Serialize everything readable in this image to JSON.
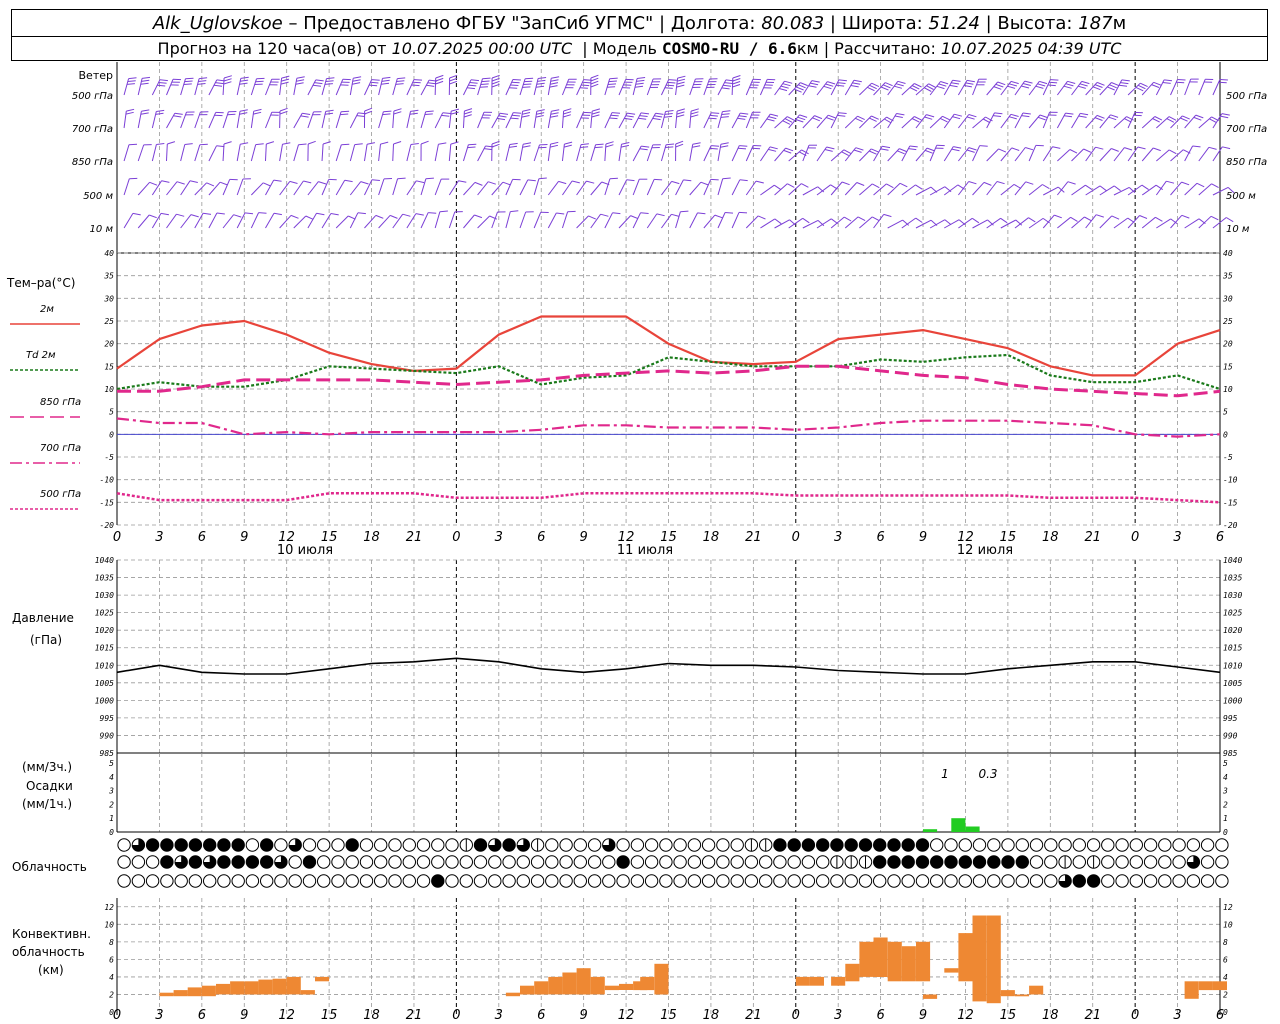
{
  "header": {
    "station": "Alk_Uglovskoe",
    "provider": " – Предоставлено ФГБУ \"ЗапСиб УГМС\" | ",
    "lon_label": "Долгота: ",
    "lon": "80.083",
    "lat_label": " | Широта: ",
    "lat": "51.24",
    "alt_label": " | Высота: ",
    "alt": "187",
    "alt_unit": "м",
    "forecast_label": "Прогноз на 120 часа(ов) от ",
    "forecast_from": "10.07.2025 00:00 UTC",
    "model_label": "  | Модель ",
    "model": "COSMO-RU / 6.6",
    "model_unit": "км",
    "computed_label": " | Рассчитано: ",
    "computed": "10.07.2025 04:39 UTC"
  },
  "labels": {
    "wind": "Ветер",
    "wind_levels": [
      "500 гПа",
      "700 гПа",
      "850 гПа",
      "500 м",
      "10  м"
    ],
    "temp": "Тем–ра(°С)",
    "legend": [
      "2м",
      "Td  2м",
      "850 гПа",
      "700 гПа",
      "500 гПа"
    ],
    "pressure": "Давление",
    "pressure_unit": "(гПа)",
    "precip_3h": "(мм/3ч.)",
    "precip": "Осадки",
    "precip_1h": "(мм/1ч.)",
    "cloud": "Облачность",
    "conv": [
      "Конвективн.",
      "облачность",
      "(км)"
    ],
    "days": [
      "10 июля",
      "11 июля",
      "12 июля"
    ],
    "precip_notes": [
      "1",
      "0.3"
    ]
  },
  "colors": {
    "t2m": "#e8443a",
    "td2m": "#1a7a1a",
    "t850": "#e0288c",
    "t700": "#e0288c",
    "t500": "#e0288c",
    "wind": "#7b3fd6",
    "precip": "#22cc22",
    "conv": "#ee8833",
    "zero_line": "#4444cc"
  },
  "chart_data": [
    {
      "type": "line",
      "name": "temperature",
      "x_hours": [
        0,
        3,
        6,
        9,
        12,
        15,
        18,
        21,
        24,
        27,
        30,
        33,
        36,
        39,
        42,
        45,
        48,
        51,
        54,
        57,
        60,
        63,
        66,
        69,
        72,
        75,
        78
      ],
      "x_tick_labels": [
        "0",
        "3",
        "6",
        "9",
        "12",
        "15",
        "18",
        "21",
        "0",
        "3",
        "6",
        "9",
        "12",
        "15",
        "18",
        "21",
        "0",
        "3",
        "6",
        "9",
        "12",
        "15",
        "18",
        "21",
        "0",
        "3",
        "6"
      ],
      "ylim": [
        -20,
        40
      ],
      "y_ticks": [
        40,
        35,
        30,
        25,
        20,
        15,
        10,
        5,
        0,
        -5,
        -10,
        -15,
        -20
      ],
      "series": [
        {
          "name": "2м",
          "values": [
            14.5,
            21,
            24,
            25,
            22,
            18,
            15.5,
            14,
            14.5,
            22,
            26,
            26,
            26,
            20,
            16,
            15.5,
            16,
            21,
            22,
            23,
            21,
            19,
            15,
            13,
            13,
            20,
            23
          ]
        },
        {
          "name": "Td 2м",
          "values": [
            10,
            11.5,
            10.5,
            10.5,
            12,
            15,
            14.5,
            14,
            13.5,
            15,
            11,
            12.5,
            13,
            17,
            16,
            15,
            15,
            15,
            16.5,
            16,
            17,
            17.5,
            13,
            11.5,
            11.5,
            13,
            10
          ]
        },
        {
          "name": "850 гПа",
          "values": [
            9.5,
            9.5,
            10.5,
            12,
            12,
            12,
            12,
            11.5,
            11,
            11.5,
            12,
            13,
            13.5,
            14,
            13.5,
            14,
            15,
            15,
            14,
            13,
            12.5,
            11,
            10,
            9.5,
            9,
            8.5,
            9.5
          ]
        },
        {
          "name": "700 гПа",
          "values": [
            3.5,
            2.5,
            2.5,
            0,
            0.5,
            0,
            0.5,
            0.5,
            0.5,
            0.5,
            1,
            2,
            2,
            1.5,
            1.5,
            1.5,
            1,
            1.5,
            2.5,
            3,
            3,
            3,
            2.5,
            2,
            0,
            -0.5,
            0
          ]
        },
        {
          "name": "500 гПа",
          "values": [
            -13,
            -14.5,
            -14.5,
            -14.5,
            -14.5,
            -13,
            -13,
            -13,
            -14,
            -14,
            -14,
            -13,
            -13,
            -13,
            -13,
            -13,
            -13.5,
            -13.5,
            -13.5,
            -13.5,
            -13.5,
            -13.5,
            -14,
            -14,
            -14,
            -14.5,
            -15
          ]
        }
      ]
    },
    {
      "type": "line",
      "name": "pressure",
      "x_hours": [
        0,
        3,
        6,
        9,
        12,
        15,
        18,
        21,
        24,
        27,
        30,
        33,
        36,
        39,
        42,
        45,
        48,
        51,
        54,
        57,
        60,
        63,
        66,
        69,
        72,
        75,
        78
      ],
      "ylim": [
        985,
        1040
      ],
      "y_ticks": [
        1040,
        1035,
        1030,
        1025,
        1020,
        1015,
        1010,
        1005,
        1000,
        995,
        990,
        985
      ],
      "values": [
        1008,
        1010,
        1008,
        1007.5,
        1007.5,
        1009,
        1010.5,
        1011,
        1012,
        1011,
        1009,
        1008,
        1009,
        1010.5,
        1010,
        1010,
        1009.5,
        1008.5,
        1008,
        1007.5,
        1007.5,
        1009,
        1010,
        1011,
        1011,
        1009.5,
        1008
      ]
    },
    {
      "type": "bar",
      "name": "precipitation",
      "ylim": [
        0,
        5
      ],
      "y_ticks": [
        5,
        4,
        3,
        2,
        1,
        0
      ],
      "bars": [
        {
          "h": 57.5,
          "v": 0.2
        },
        {
          "h": 59.5,
          "v": 1.0
        },
        {
          "h": 60.5,
          "v": 0.4
        }
      ]
    },
    {
      "type": "table",
      "name": "cloudiness",
      "rows": [
        "0344444440403000400000002434320000300000000022444444444440000000000000000",
        "0004343444430400000000000000000000040000000000000022244444444444002020000003",
        "0000000000000000000000400000000000000000000000000000000000000000003440000000"
      ]
    },
    {
      "type": "bar",
      "name": "convective clouds",
      "ylim": [
        0,
        13
      ],
      "y_ticks": [
        12,
        10,
        8,
        6,
        4,
        2,
        0
      ],
      "bars": [
        {
          "h": 3.5,
          "lo": 1.8,
          "hi": 2.2
        },
        {
          "h": 4.5,
          "lo": 1.8,
          "hi": 2.5
        },
        {
          "h": 5.5,
          "lo": 1.8,
          "hi": 2.8
        },
        {
          "h": 6.5,
          "lo": 1.8,
          "hi": 3
        },
        {
          "h": 7.5,
          "lo": 2,
          "hi": 3.2
        },
        {
          "h": 8.5,
          "lo": 2,
          "hi": 3.5
        },
        {
          "h": 9.5,
          "lo": 2,
          "hi": 3.5
        },
        {
          "h": 10.5,
          "lo": 2,
          "hi": 3.7
        },
        {
          "h": 11.5,
          "lo": 2,
          "hi": 3.8
        },
        {
          "h": 12.5,
          "lo": 2,
          "hi": 4
        },
        {
          "h": 13.5,
          "lo": 2,
          "hi": 2.5
        },
        {
          "h": 14.5,
          "lo": 3.5,
          "hi": 4
        },
        {
          "h": 28,
          "lo": 1.8,
          "hi": 2.2
        },
        {
          "h": 29,
          "lo": 2,
          "hi": 3
        },
        {
          "h": 30,
          "lo": 2,
          "hi": 3.5
        },
        {
          "h": 31,
          "lo": 2,
          "hi": 4
        },
        {
          "h": 32,
          "lo": 2,
          "hi": 4.5
        },
        {
          "h": 33,
          "lo": 2,
          "hi": 5
        },
        {
          "h": 34,
          "lo": 2,
          "hi": 4
        },
        {
          "h": 35,
          "lo": 2.5,
          "hi": 3
        },
        {
          "h": 36,
          "lo": 2.5,
          "hi": 3.2
        },
        {
          "h": 37,
          "lo": 2.5,
          "hi": 3.5
        },
        {
          "h": 37.5,
          "lo": 2.5,
          "hi": 4
        },
        {
          "h": 38.5,
          "lo": 2,
          "hi": 5.5
        },
        {
          "h": 48.5,
          "lo": 3,
          "hi": 4
        },
        {
          "h": 49.5,
          "lo": 3,
          "hi": 4
        },
        {
          "h": 51,
          "lo": 3,
          "hi": 4
        },
        {
          "h": 52,
          "lo": 3.5,
          "hi": 5.5
        },
        {
          "h": 53,
          "lo": 4,
          "hi": 8
        },
        {
          "h": 54,
          "lo": 4,
          "hi": 8.5
        },
        {
          "h": 55,
          "lo": 3.5,
          "hi": 8
        },
        {
          "h": 56,
          "lo": 3.5,
          "hi": 7.5
        },
        {
          "h": 57,
          "lo": 3.5,
          "hi": 8
        },
        {
          "h": 57.5,
          "lo": 1.5,
          "hi": 2
        },
        {
          "h": 59,
          "lo": 4.5,
          "hi": 5
        },
        {
          "h": 60,
          "lo": 3.5,
          "hi": 9
        },
        {
          "h": 61,
          "lo": 1.2,
          "hi": 11
        },
        {
          "h": 62,
          "lo": 1,
          "hi": 11
        },
        {
          "h": 63,
          "lo": 1.8,
          "hi": 2.5
        },
        {
          "h": 64,
          "lo": 1.8,
          "hi": 2
        },
        {
          "h": 65,
          "lo": 2,
          "hi": 3
        },
        {
          "h": 76,
          "lo": 1.5,
          "hi": 3.5
        },
        {
          "h": 77,
          "lo": 2.5,
          "hi": 3.5
        },
        {
          "h": 78,
          "lo": 2.5,
          "hi": 3.5
        }
      ]
    },
    {
      "type": "scatter",
      "name": "wind",
      "levels": [
        "500 гПа",
        "700 гПа",
        "850 гПа",
        "500 м",
        "10  м"
      ],
      "samples_per_level": 78
    }
  ]
}
